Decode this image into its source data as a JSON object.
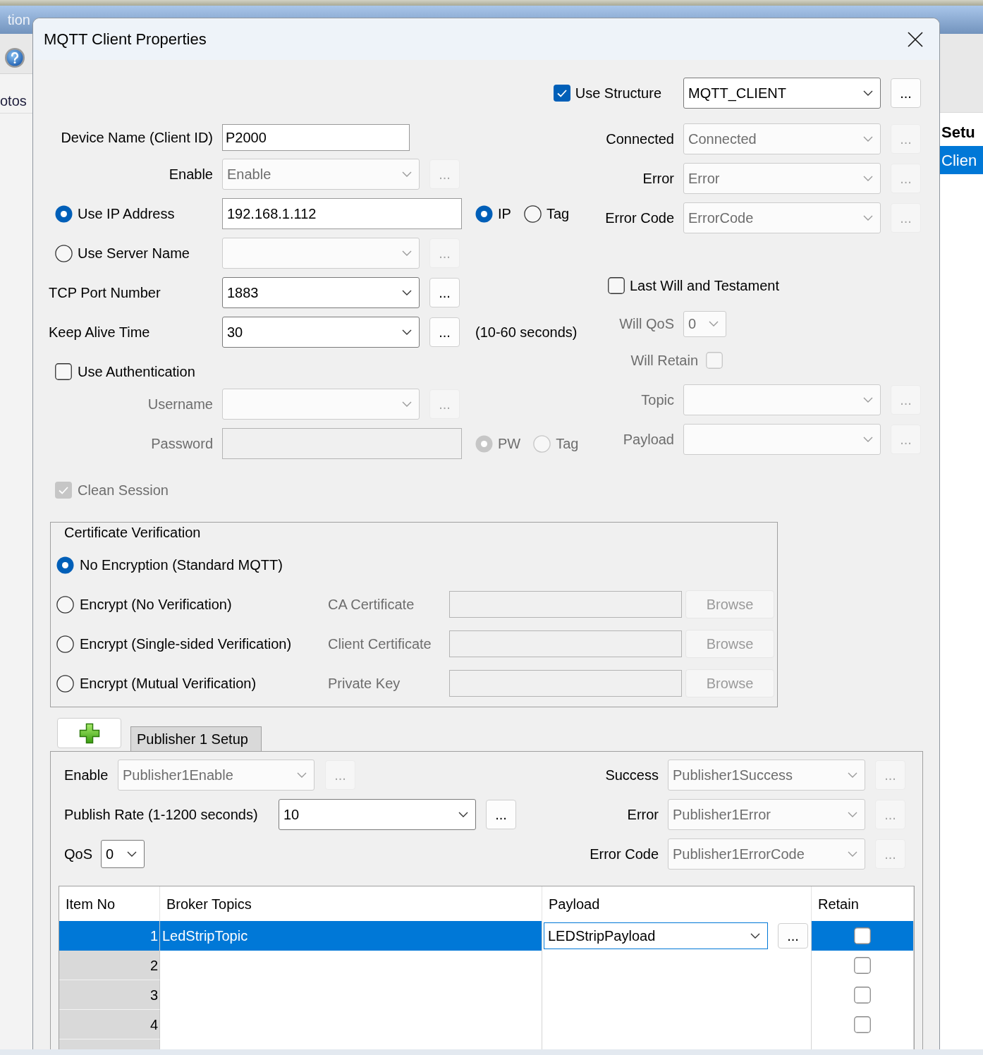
{
  "background": {
    "title_fragment": "tion",
    "toolbar_item": "otos",
    "side_heading": "Setu",
    "side_items": [
      {
        "label": "Clien",
        "selected": true
      }
    ]
  },
  "window": {
    "title": "MQTT Client Properties"
  },
  "use_structure": {
    "label": "Use Structure",
    "checked": true,
    "value": "MQTT_CLIENT",
    "disabled": false,
    "button": "..."
  },
  "device_name": {
    "label": "Device Name (Client ID)",
    "value": "P2000"
  },
  "enable": {
    "label": "Enable",
    "value": "Enable",
    "disabled": true,
    "button": "..."
  },
  "address_mode": [
    {
      "label": "Use IP Address",
      "selected": true
    },
    {
      "label": "Use Server Name",
      "selected": false
    }
  ],
  "ip_address": {
    "value": "192.168.1.112"
  },
  "ip_source": [
    {
      "label": "IP",
      "selected": true
    },
    {
      "label": "Tag",
      "selected": false
    }
  ],
  "server_name": {
    "disabled": true,
    "button": "..."
  },
  "tcp_port": {
    "label": "TCP Port Number",
    "value": "1883",
    "disabled": false,
    "button": "..."
  },
  "keep_alive": {
    "label": "Keep Alive Time",
    "value": "30",
    "disabled": false,
    "button": "...",
    "hint": "(10-60 seconds)"
  },
  "authentication": {
    "label": "Use Authentication",
    "checked": false
  },
  "username": {
    "label": "Username",
    "disabled": true,
    "button": "..."
  },
  "password": {
    "label": "Password",
    "disabled": true,
    "source": [
      {
        "label": "PW",
        "selected": true
      },
      {
        "label": "Tag",
        "selected": false
      }
    ]
  },
  "clean_session": {
    "label": "Clean Session",
    "checked": true,
    "disabled": true
  },
  "status_tags": [
    {
      "label": "Connected",
      "value": "Connected",
      "disabled": true,
      "button": "..."
    },
    {
      "label": "Error",
      "value": "Error",
      "disabled": true,
      "button": "..."
    },
    {
      "label": "Error Code",
      "value": "ErrorCode",
      "disabled": true,
      "button": "..."
    }
  ],
  "last_will": {
    "label": "Last Will and Testament",
    "checked": false
  },
  "will_qos": {
    "label": "Will QoS",
    "value": "0",
    "disabled": true
  },
  "will_retain": {
    "label": "Will Retain",
    "checked": false,
    "disabled": true
  },
  "will_fields": [
    {
      "label": "Topic",
      "disabled": true,
      "button": "..."
    },
    {
      "label": "Payload",
      "disabled": true,
      "button": "..."
    }
  ],
  "certificate_verification": {
    "title": "Certificate Verification",
    "options": [
      {
        "label": "No Encryption (Standard MQTT)",
        "selected": true
      },
      {
        "label": "Encrypt (No Verification)",
        "selected": false,
        "file_label": "CA Certificate",
        "disabled": true,
        "button": "Browse"
      },
      {
        "label": "Encrypt (Single-sided Verification)",
        "selected": false,
        "file_label": "Client Certificate",
        "disabled": true,
        "button": "Browse"
      },
      {
        "label": "Encrypt (Mutual Verification)",
        "selected": false,
        "file_label": "Private Key",
        "disabled": true,
        "button": "Browse"
      }
    ]
  },
  "publisher_tabs": [
    {
      "label": "Publisher 1 Setup",
      "selected": true
    }
  ],
  "publisher": {
    "left": [
      {
        "label": "Enable",
        "value": "Publisher1Enable",
        "disabled": true,
        "button": "..."
      },
      {
        "label": "Publish Rate (1-1200 seconds)",
        "value": "10",
        "disabled": false,
        "button": "..."
      },
      {
        "label": "QoS",
        "value": "0",
        "disabled": false
      }
    ],
    "right": [
      {
        "label": "Success",
        "value": "Publisher1Success",
        "disabled": true,
        "button": "..."
      },
      {
        "label": "Error",
        "value": "Publisher1Error",
        "disabled": true,
        "button": "..."
      },
      {
        "label": "Error Code",
        "value": "Publisher1ErrorCode",
        "disabled": true,
        "button": "..."
      }
    ]
  },
  "topics_table": {
    "columns": [
      "Item No",
      "Broker Topics",
      "Payload",
      "Retain"
    ],
    "rows": [
      {
        "item_no": "1",
        "broker_topic": "LedStripTopic",
        "payload": "LEDStripPayload",
        "payload_button": "...",
        "retain": false,
        "selected": true
      },
      {
        "item_no": "2",
        "retain": false,
        "selected": false
      },
      {
        "item_no": "3",
        "retain": false,
        "selected": false
      },
      {
        "item_no": "4",
        "retain": false,
        "selected": false
      }
    ]
  }
}
